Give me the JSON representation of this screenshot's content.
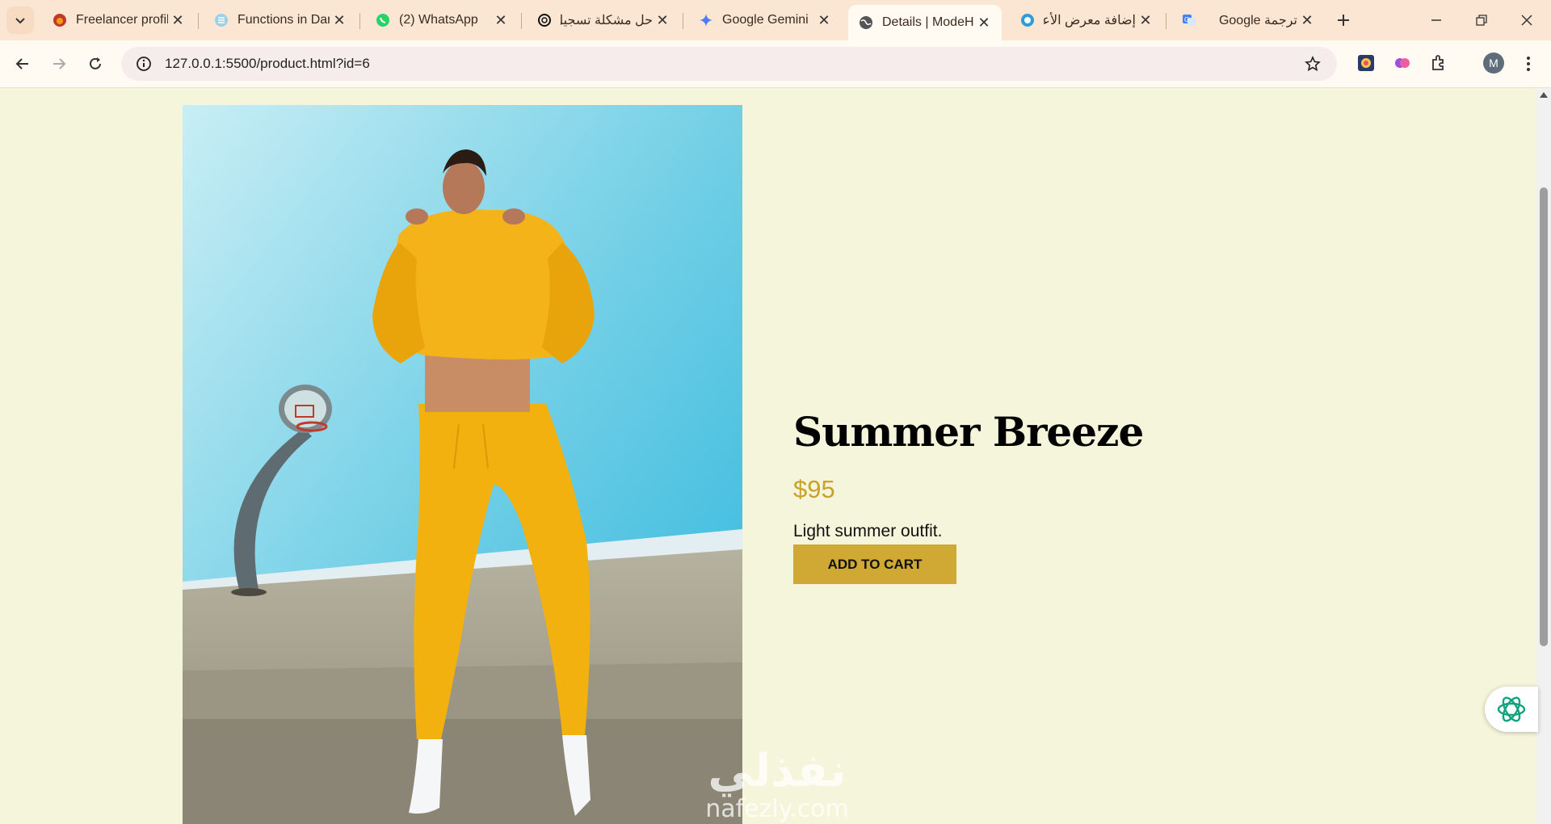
{
  "browser": {
    "tabs": [
      {
        "title": "Freelancer profile",
        "icon": "freelancer-favicon"
      },
      {
        "title": "Functions in Dart",
        "icon": "dart-favicon"
      },
      {
        "title": "(2) WhatsApp",
        "icon": "whatsapp-favicon"
      },
      {
        "title": "حل مشكلة تسجيل",
        "icon": "chatgpt-favicon"
      },
      {
        "title": "Google Gemini",
        "icon": "gemini-favicon"
      },
      {
        "title": "Details | ModeHaven",
        "icon": "globe-favicon",
        "active": true
      },
      {
        "title": "إضافة معرض الأعمال",
        "icon": "circle-favicon"
      },
      {
        "title": "ترجمة Google",
        "icon": "google-translate-favicon"
      }
    ],
    "url": "127.0.0.1:5500/product.html?id=6",
    "profile_initial": "M"
  },
  "product": {
    "name": "Summer Breeze",
    "price": "$95",
    "description": "Light summer outfit.",
    "cta_label": "ADD TO CART"
  },
  "watermark": {
    "arabic": "نفذلي",
    "latin": "nafezly.com"
  },
  "colors": {
    "page_bg": "#f5f5dc",
    "price": "#c9a227",
    "button": "#cfa934",
    "tabstrip": "#fbe6d3"
  }
}
